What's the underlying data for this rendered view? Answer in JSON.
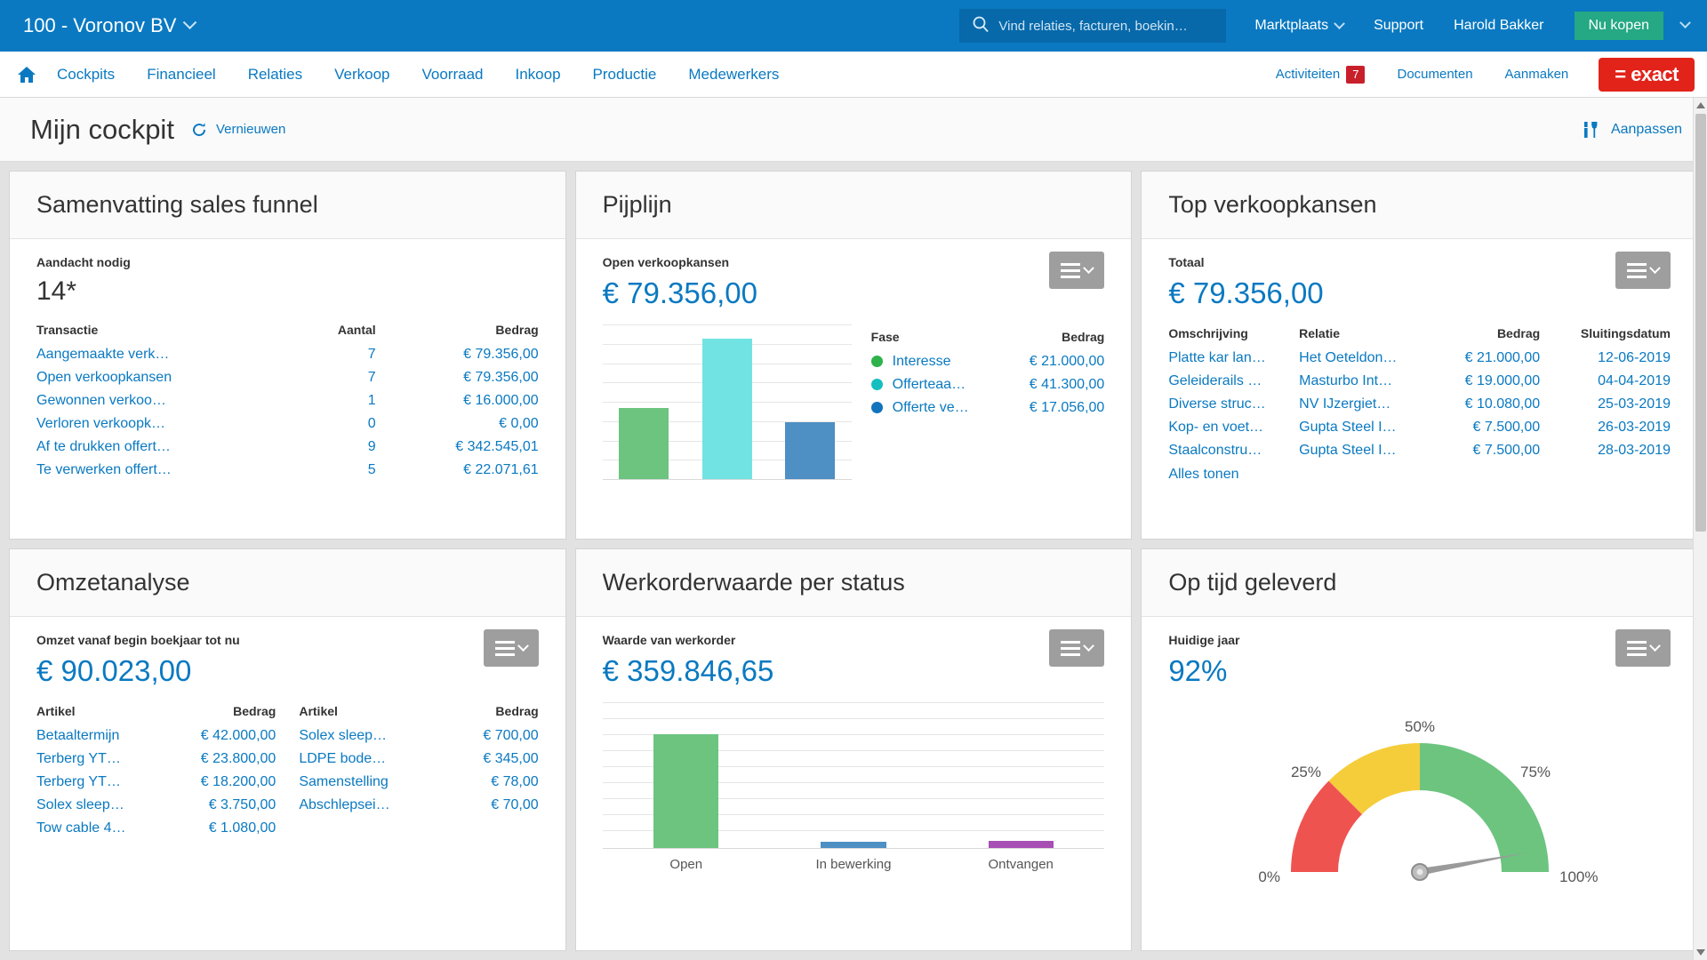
{
  "topbar": {
    "company": "100 - Voronov BV",
    "search_placeholder": "Vind relaties, facturen, boekin…",
    "marktplaats": "Marktplaats",
    "support": "Support",
    "user": "Harold Bakker",
    "buy": "Nu kopen"
  },
  "nav": {
    "items": [
      "Cockpits",
      "Financieel",
      "Relaties",
      "Verkoop",
      "Voorraad",
      "Inkoop",
      "Productie",
      "Medewerkers"
    ],
    "activiteiten": "Activiteiten",
    "activiteiten_count": "7",
    "documenten": "Documenten",
    "aanmaken": "Aanmaken",
    "logo": "= exact"
  },
  "page": {
    "title": "Mijn cockpit",
    "refresh": "Vernieuwen",
    "customize": "Aanpassen"
  },
  "panels": {
    "funnel": {
      "title": "Samenvatting sales funnel",
      "sublabel": "Aandacht nodig",
      "value": "14*",
      "columns": [
        "Transactie",
        "Aantal",
        "Bedrag"
      ],
      "rows": [
        [
          "Aangemaakte verk…",
          "7",
          "€ 79.356,00"
        ],
        [
          "Open verkoopkansen",
          "7",
          "€ 79.356,00"
        ],
        [
          "Gewonnen verkoo…",
          "1",
          "€ 16.000,00"
        ],
        [
          "Verloren verkoopk…",
          "0",
          "€ 0,00"
        ],
        [
          "Af te drukken offert…",
          "9",
          "€ 342.545,01"
        ],
        [
          "Te verwerken offert…",
          "5",
          "€ 22.071,61"
        ]
      ]
    },
    "pipeline": {
      "title": "Pijplijn",
      "sublabel": "Open verkoopkansen",
      "value": "€ 79.356,00",
      "columns": [
        "Fase",
        "Bedrag"
      ],
      "rows": [
        {
          "label": "Interesse",
          "amount": "€ 21.000,00",
          "color": "#5cb85c"
        },
        {
          "label": "Offerteaa…",
          "amount": "€ 41.300,00",
          "color": "#16bfbf"
        },
        {
          "label": "Offerte ve…",
          "amount": "€ 17.056,00",
          "color": "#1273bd"
        }
      ]
    },
    "topopps": {
      "title": "Top verkoopkansen",
      "sublabel": "Totaal",
      "value": "€ 79.356,00",
      "columns": [
        "Omschrijving",
        "Relatie",
        "Bedrag",
        "Sluitingsdatum"
      ],
      "rows": [
        [
          "Platte kar lan…",
          "Het Oeteldon…",
          "€ 21.000,00",
          "12-06-2019"
        ],
        [
          "Geleiderails …",
          "Masturbo Int…",
          "€ 19.000,00",
          "04-04-2019"
        ],
        [
          "Diverse struc…",
          "NV IJzergiet…",
          "€ 10.080,00",
          "25-03-2019"
        ],
        [
          "Kop- en voet…",
          "Gupta Steel I…",
          "€ 7.500,00",
          "26-03-2019"
        ],
        [
          "Staalconstru…",
          "Gupta Steel I…",
          "€ 7.500,00",
          "28-03-2019"
        ]
      ],
      "show_all": "Alles tonen"
    },
    "revenue": {
      "title": "Omzetanalyse",
      "sublabel": "Omzet vanaf begin boekjaar tot nu",
      "value": "€ 90.023,00",
      "columns": [
        "Artikel",
        "Bedrag"
      ],
      "rows_left": [
        [
          "Betaaltermijn",
          "€ 42.000,00"
        ],
        [
          "Terberg YT…",
          "€ 23.800,00"
        ],
        [
          "Terberg YT…",
          "€ 18.200,00"
        ],
        [
          "Solex sleep…",
          "€ 3.750,00"
        ],
        [
          "Tow cable 4…",
          "€ 1.080,00"
        ]
      ],
      "rows_right": [
        [
          "Solex sleep…",
          "€ 700,00"
        ],
        [
          "LDPE bode…",
          "€ 345,00"
        ],
        [
          "Samenstelling",
          "€ 78,00"
        ],
        [
          "Abschlepsei…",
          "€ 70,00"
        ]
      ]
    },
    "workorder": {
      "title": "Werkorderwaarde per status",
      "sublabel": "Waarde van werkorder",
      "value": "€ 359.846,65"
    },
    "ontime": {
      "title": "Op tijd geleverd",
      "sublabel": "Huidige jaar",
      "value": "92%"
    }
  },
  "chart_data": [
    {
      "type": "bar",
      "title": "Pijplijn - Open verkoopkansen",
      "categories": [
        "Interesse",
        "Offerteaanvraag",
        "Offerte verzonden"
      ],
      "values": [
        21000,
        41300,
        17056
      ],
      "colors": [
        "#6cc47f",
        "#71e3e3",
        "#4e8fc4"
      ],
      "ylim": [
        0,
        45000
      ],
      "grid": true,
      "xlabel": "",
      "ylabel": "Bedrag",
      "legend": "right"
    },
    {
      "type": "bar",
      "title": "Werkorderwaarde per status",
      "categories": [
        "Open",
        "In bewerking",
        "Ontvangen"
      ],
      "values": [
        359000,
        12000,
        13500
      ],
      "colors": [
        "#6cc47f",
        "#4e8fc4",
        "#a84fb5"
      ],
      "ylim": [
        0,
        450000
      ],
      "grid": true,
      "xlabel": "",
      "ylabel": "Waarde van werkorder",
      "legend": "none"
    },
    {
      "type": "gauge",
      "title": "Op tijd geleverd",
      "value": 92,
      "ylim": [
        0,
        100
      ],
      "ticks": [
        "0%",
        "25%",
        "50%",
        "75%",
        "100%"
      ],
      "bands": [
        {
          "from": 0,
          "to": 25,
          "color": "#ef5350"
        },
        {
          "from": 25,
          "to": 50,
          "color": "#f5cd3b"
        },
        {
          "from": 50,
          "to": 100,
          "color": "#6cc47f"
        }
      ]
    }
  ]
}
